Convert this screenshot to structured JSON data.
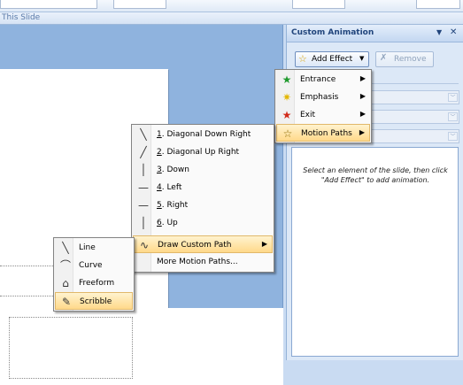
{
  "subbar": {
    "text": "This Slide"
  },
  "pane": {
    "title": "Custom Animation",
    "add_effect": "Add Effect",
    "remove": "Remove",
    "hint": "Select an element of the slide, then click \"Add Effect\" to add animation."
  },
  "effect_menu": [
    {
      "label": "Entrance",
      "icon": "green-star-icon"
    },
    {
      "label": "Emphasis",
      "icon": "yellow-star-icon"
    },
    {
      "label": "Exit",
      "icon": "red-star-icon"
    },
    {
      "label": "Motion Paths",
      "icon": "outline-star-icon",
      "highlighted": true
    }
  ],
  "motion_menu": [
    {
      "key": "1",
      "label": ". Diagonal Down Right",
      "icon": "diagonal-down-icon"
    },
    {
      "key": "2",
      "label": ". Diagonal Up Right",
      "icon": "diagonal-up-icon"
    },
    {
      "key": "3",
      "label": ". Down",
      "icon": "line-down-icon"
    },
    {
      "key": "4",
      "label": ". Left",
      "icon": "line-left-icon"
    },
    {
      "key": "5",
      "label": ". Right",
      "icon": "line-right-icon"
    },
    {
      "key": "6",
      "label": ". Up",
      "icon": "line-up-icon"
    },
    {
      "label": "Draw Custom Path",
      "icon": "custom-path-icon",
      "highlighted": true
    },
    {
      "label": "More Motion Paths...",
      "icon": ""
    }
  ],
  "custom_menu": [
    {
      "label": "Line",
      "icon": "line-tool-icon"
    },
    {
      "label": "Curve",
      "icon": "curve-tool-icon"
    },
    {
      "label": "Freeform",
      "icon": "freeform-tool-icon"
    },
    {
      "label": "Scribble",
      "icon": "scribble-tool-icon",
      "highlighted": true
    }
  ]
}
